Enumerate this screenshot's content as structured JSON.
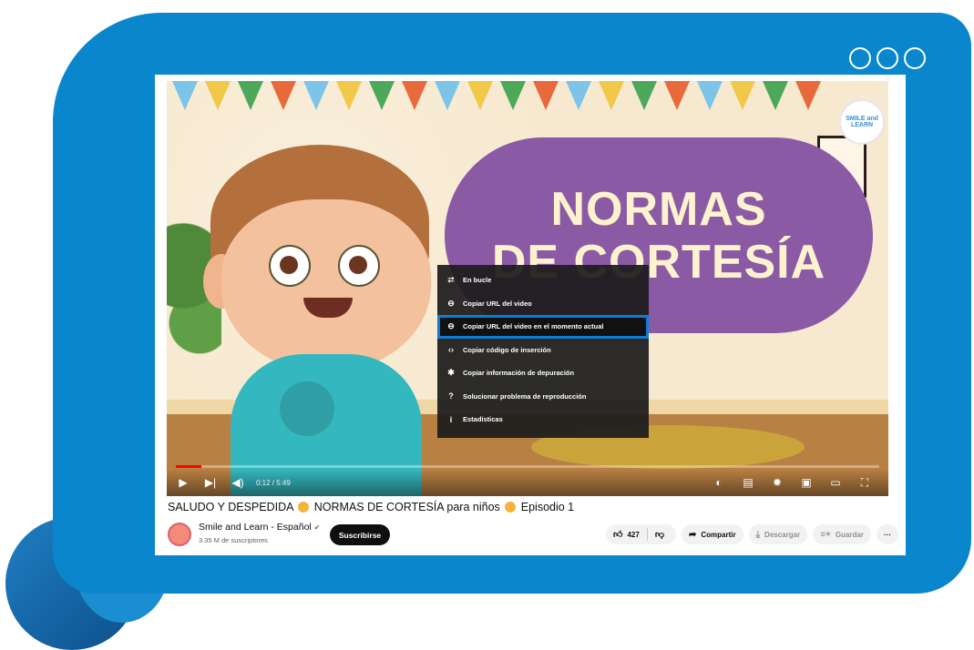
{
  "frame": {
    "window_dots": [
      "dot",
      "dot",
      "dot"
    ]
  },
  "video": {
    "banner_line1": "NORMAS",
    "banner_line2": "DE CORTESÍA",
    "logo_text": "SMILE and LEARN",
    "progress_percent": 3.6,
    "time_display": "0:12 / 5:49",
    "controls": {
      "left": [
        "play-icon",
        "next-icon",
        "volume-icon"
      ],
      "right": [
        "autoplay-toggle-icon",
        "subtitles-icon",
        "settings-icon",
        "miniplayer-icon",
        "theater-icon",
        "fullscreen-icon"
      ]
    }
  },
  "context_menu": {
    "items": [
      {
        "icon": "loop-icon",
        "glyph": "⮂",
        "label": "En bucle"
      },
      {
        "icon": "link-icon",
        "glyph": "⊖",
        "label": "Copiar URL del video"
      },
      {
        "icon": "link-icon",
        "glyph": "⊖",
        "label": "Copiar URL del video en el momento actual",
        "active": true
      },
      {
        "icon": "code-icon",
        "glyph": "‹›",
        "label": "Copiar código de inserción"
      },
      {
        "icon": "bug-icon",
        "glyph": "✱",
        "label": "Copiar información de depuración"
      },
      {
        "icon": "help-icon",
        "glyph": "?",
        "label": "Solucionar problema de reproducción"
      },
      {
        "icon": "info-icon",
        "glyph": "i",
        "label": "Estadísticas"
      }
    ]
  },
  "meta": {
    "title_part1": "SALUDO Y DESPEDIDA",
    "title_part2": "NORMAS DE CORTESÍA para niños",
    "title_part3": "Episodio 1",
    "channel_name": "Smile and Learn - Español",
    "verified_mark": "✔",
    "subscribers": "3.35 M de suscriptores",
    "subscribe_label": "Suscribirse",
    "like_count": "427",
    "share_label": "Compartir",
    "download_label": "Descargar",
    "save_label": "Guardar",
    "more_label": "···"
  },
  "colors": {
    "frame_blue": "#0a86cc",
    "bubble_purple": "#8b5aa5",
    "menu_highlight": "#0e7cd4",
    "progress_red": "#ff0000"
  }
}
